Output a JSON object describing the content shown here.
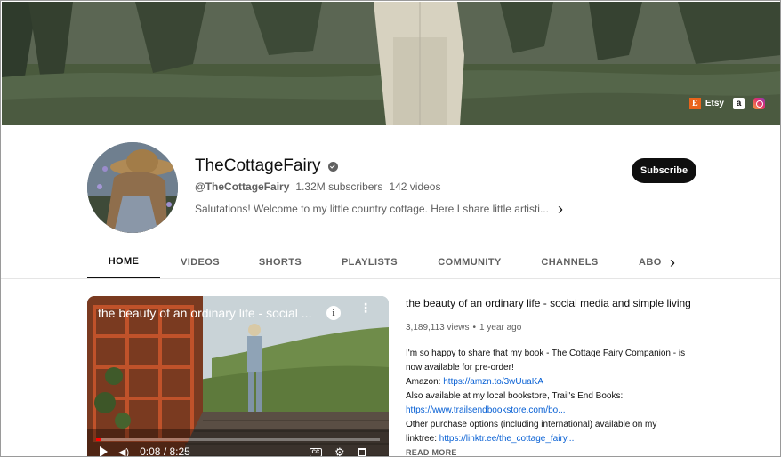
{
  "banner": {
    "links": [
      {
        "name": "etsy",
        "icon": "etsy-icon",
        "glyph": "E",
        "label": "Etsy"
      },
      {
        "name": "amazon",
        "icon": "amazon-icon",
        "glyph": "a",
        "label": ""
      },
      {
        "name": "instagram",
        "icon": "instagram-icon",
        "label": ""
      }
    ]
  },
  "channel": {
    "name": "TheCottageFairy",
    "handle": "@TheCottageFairy",
    "subscribers": "1.32M subscribers",
    "videos": "142 videos",
    "description": "Salutations! Welcome to my little country cottage. Here I share little artisti...",
    "subscribe_label": "Subscribe"
  },
  "tabs": [
    {
      "label": "HOME",
      "active": true
    },
    {
      "label": "VIDEOS",
      "active": false
    },
    {
      "label": "SHORTS",
      "active": false
    },
    {
      "label": "PLAYLISTS",
      "active": false
    },
    {
      "label": "COMMUNITY",
      "active": false
    },
    {
      "label": "CHANNELS",
      "active": false
    },
    {
      "label": "ABO",
      "active": false
    }
  ],
  "featured_video": {
    "overlay_title": "the beauty of an ordinary life - social ...",
    "info_glyph": "i",
    "time": "0:08 / 8:25",
    "progress_fraction": 0.016,
    "cc_label": "CC",
    "title": "the beauty of an ordinary life - social media and simple living",
    "views": "3,189,113 views",
    "separator": "•",
    "age": "1 year ago",
    "description": [
      {
        "text": "I'm so happy to share that my book - The Cottage Fairy Companion - is now available for pre-order!"
      },
      {
        "text": "Amazon: ",
        "link": "https://amzn.to/3wUuaKA"
      },
      {
        "text": "Also available at my local bookstore, Trail's End Books:"
      },
      {
        "text": "",
        "link": "https://www.trailsendbookstore.com/bo..."
      },
      {
        "text": "Other purchase options (including international) available on my linktree: ",
        "link": "https://linktr.ee/the_cottage_fairy..."
      }
    ],
    "read_more": "READ MORE"
  },
  "colors": {
    "accent": "#0f0f0f",
    "link": "#065fd4",
    "progress": "#ff0000",
    "secondary_text": "#606060"
  }
}
